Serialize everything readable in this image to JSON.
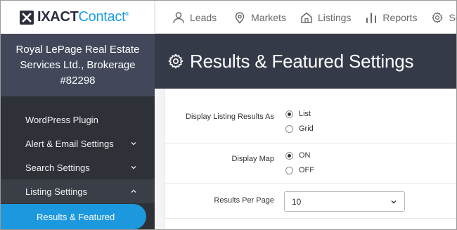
{
  "brand": {
    "name_bold": "IXACT",
    "name_light": "Contact",
    "trademark": "®"
  },
  "nav": [
    {
      "label": "Leads",
      "icon": "person-icon"
    },
    {
      "label": "Markets",
      "icon": "map-pin-icon"
    },
    {
      "label": "Listings",
      "icon": "house-icon"
    },
    {
      "label": "Reports",
      "icon": "bar-chart-icon"
    },
    {
      "label": "Setup",
      "icon": "gear-icon"
    }
  ],
  "sidebar": {
    "account_line1": "Royal LePage Real Estate",
    "account_line2": "Services Ltd., Brokerage",
    "account_line3": "#82298",
    "items": [
      {
        "label": "WordPress Plugin"
      },
      {
        "label": "Alert & Email Settings"
      },
      {
        "label": "Search Settings"
      },
      {
        "label": "Listing Settings"
      }
    ],
    "active_sub": "Results & Featured"
  },
  "page": {
    "title": "Results & Featured Settings"
  },
  "settings": {
    "display_results": {
      "label": "Display Listing Results As",
      "options": [
        "List",
        "Grid"
      ],
      "selected": "List"
    },
    "display_map": {
      "label": "Display Map",
      "options": [
        "ON",
        "OFF"
      ],
      "selected": "ON"
    },
    "results_per_page": {
      "label": "Results Per Page",
      "value": "10"
    }
  },
  "colors": {
    "accent": "#1c98de",
    "sidebar": "#2e3138",
    "header": "#353a48",
    "account": "#42485a"
  }
}
